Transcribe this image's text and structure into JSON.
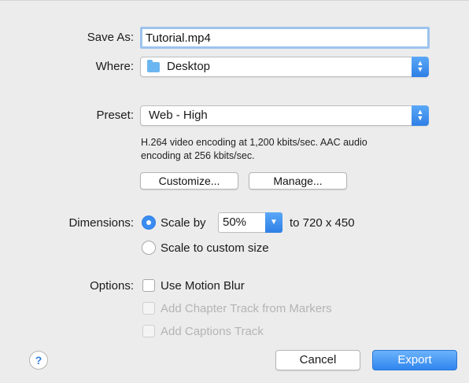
{
  "save_as": {
    "label": "Save As:",
    "value": "Tutorial.mp4"
  },
  "where": {
    "label": "Where:",
    "value": "Desktop",
    "icon": "folder-icon"
  },
  "preset": {
    "label": "Preset:",
    "value": "Web - High",
    "description_line1": "H.264 video encoding at 1,200 kbits/sec.  AAC audio",
    "description_line2": "encoding at 256 kbits/sec."
  },
  "buttons": {
    "customize": "Customize...",
    "manage": "Manage..."
  },
  "dimensions": {
    "label": "Dimensions:",
    "scale_by_label": "Scale by",
    "scale_value": "50%",
    "result": "to 720 x 450",
    "custom_label": "Scale to custom size"
  },
  "options": {
    "label": "Options:",
    "motion_blur": "Use Motion Blur",
    "chapter_track": "Add Chapter Track from Markers",
    "captions_track": "Add Captions Track"
  },
  "footer": {
    "help": "?",
    "cancel": "Cancel",
    "export": "Export"
  },
  "colors": {
    "accent": "#2f7fe6",
    "disabled_text": "#b4b4b4"
  }
}
